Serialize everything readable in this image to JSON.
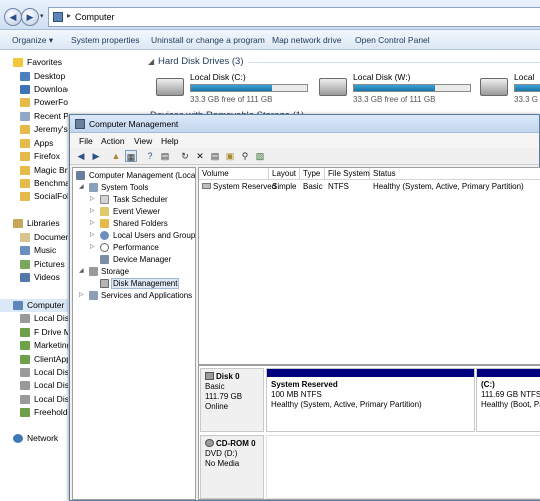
{
  "explorer": {
    "address": "Computer",
    "toolbar": [
      "Organize ▾",
      "System properties",
      "Uninstall or change a program",
      "Map network drive",
      "Open Control Panel"
    ],
    "nav": {
      "favorites_header": "Favorites",
      "favorites": [
        "Desktop",
        "Downloads",
        "PowerFolders",
        "Recent Pla",
        "Jeremy's f",
        "Apps",
        "Firefox",
        "Magic Bri",
        "Benchma",
        "SocialFolc"
      ],
      "libraries_header": "Libraries",
      "libraries": [
        "Documen",
        "Music",
        "Pictures",
        "Videos"
      ],
      "computer_header": "Computer",
      "computer": [
        "Local Disk",
        "F Drive Mi",
        "Marketing",
        "ClientApp",
        "Local Disk",
        "Local Disk",
        "Local Disk",
        "Freehold F"
      ],
      "network_header": "Network"
    },
    "hard_disk_header": "Hard Disk Drives (3)",
    "removable_header": "Devices with Removable Storage (1)",
    "drives": [
      {
        "name": "Local Disk (C:)",
        "free": "33.3 GB free of 111 GB",
        "used_fraction": 0.7
      },
      {
        "name": "Local Disk (W:)",
        "free": "33.3 GB free of 111 GB",
        "used_fraction": 0.7
      },
      {
        "name": "Local D",
        "free": "33.3 G",
        "used_fraction": 0.7
      }
    ]
  },
  "cm": {
    "title": "Computer Management",
    "menu": [
      "File",
      "Action",
      "View",
      "Help"
    ],
    "toolbar_icons": [
      "back-icon",
      "forward-icon",
      "up-icon",
      "show-hide-tree-icon",
      "help-icon",
      "properties-icon",
      "refresh-icon",
      "delete-icon",
      "export-icon",
      "open-icon",
      "search-icon",
      "console-icon"
    ],
    "tree": [
      {
        "label": "Computer Management (Local",
        "level": 0,
        "expander": ""
      },
      {
        "label": "System Tools",
        "level": 1,
        "expander": "◢"
      },
      {
        "label": "Task Scheduler",
        "level": 2,
        "expander": "▷"
      },
      {
        "label": "Event Viewer",
        "level": 2,
        "expander": "▷"
      },
      {
        "label": "Shared Folders",
        "level": 2,
        "expander": "▷"
      },
      {
        "label": "Local Users and Groups",
        "level": 2,
        "expander": "▷"
      },
      {
        "label": "Performance",
        "level": 2,
        "expander": "▷"
      },
      {
        "label": "Device Manager",
        "level": 2,
        "expander": ""
      },
      {
        "label": "Storage",
        "level": 1,
        "expander": "◢"
      },
      {
        "label": "Disk Management",
        "level": 2,
        "expander": "",
        "selected": true
      },
      {
        "label": "Services and Applications",
        "level": 1,
        "expander": "▷"
      }
    ],
    "volume_columns": [
      "Volume",
      "Layout",
      "Type",
      "File System",
      "Status"
    ],
    "volumes": [
      {
        "volume": "System Reserved",
        "layout": "Simple",
        "type": "Basic",
        "fs": "NTFS",
        "status": "Healthy (System, Active, Primary Partition)"
      }
    ],
    "disks": [
      {
        "name": "Disk 0",
        "kind": "Basic",
        "size": "111.79 GB",
        "state": "Online",
        "partitions": [
          {
            "title": "System Reserved",
            "size": "100 MB NTFS",
            "status": "Healthy (System, Active, Primary Partition)"
          },
          {
            "title": "(C:)",
            "size": "111.69 GB NTFS",
            "status": "Healthy (Boot, Pa"
          }
        ]
      },
      {
        "name": "CD-ROM 0",
        "kind": "DVD (D:)",
        "size": "",
        "state": "No Media"
      }
    ]
  },
  "colors": {
    "partition_bar": "#00007f",
    "drive_fill": "#2189c2",
    "header_text": "#1e395b"
  }
}
